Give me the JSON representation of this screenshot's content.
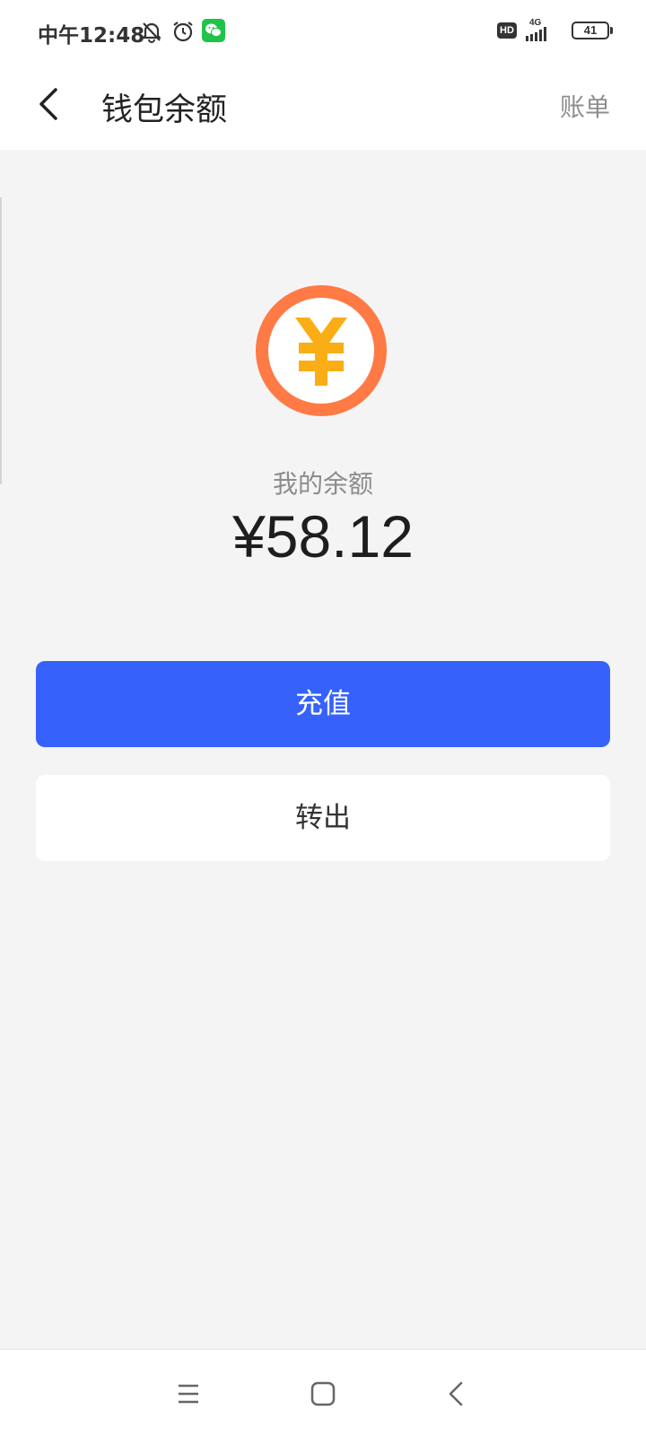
{
  "status_bar": {
    "time": "中午12:48",
    "hd_label": "HD",
    "network_label": "4G",
    "battery_level": "41",
    "icons": [
      "mute-bell-icon",
      "alarm-icon",
      "wechat-icon",
      "signal-icon",
      "battery-icon"
    ]
  },
  "header": {
    "title": "钱包余额",
    "bill_label": "账单",
    "back_icon": "back-arrow-icon"
  },
  "balance": {
    "label": "我的余额",
    "amount": "¥58.12",
    "coin_icon": "yuan-coin-icon"
  },
  "actions": {
    "recharge_label": "充值",
    "withdraw_label": "转出"
  },
  "nav_bar": {
    "icons": [
      "menu-icon",
      "home-icon",
      "back-icon"
    ]
  },
  "colors": {
    "primary": "#3662fb",
    "coin_ring": "#ff7a45",
    "coin_symbol": "#faad14",
    "background": "#f4f4f4"
  }
}
